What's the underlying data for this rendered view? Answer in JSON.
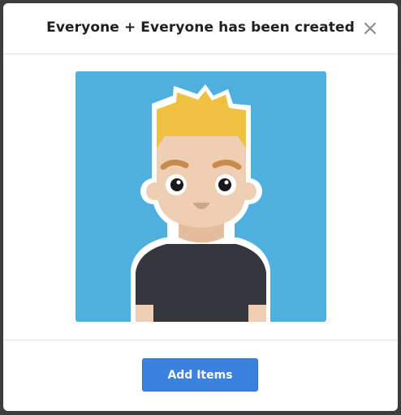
{
  "modal": {
    "title": "Everyone + Everyone has been created",
    "close_icon": "close-icon",
    "avatar": {
      "icon": "person-avatar-illustration",
      "background_color": "#4fb0e0",
      "hair_color": "#f0c040",
      "skin_color": "#efcfb4",
      "shirt_color": "#36373d"
    },
    "footer": {
      "add_items_label": "Add Items",
      "button_color": "#3b82e0"
    }
  }
}
